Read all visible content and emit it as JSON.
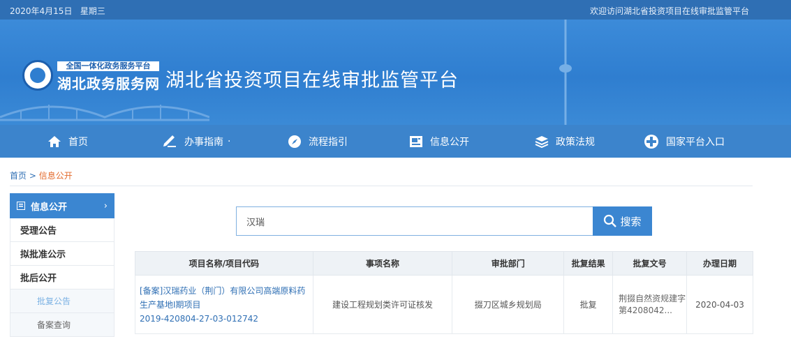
{
  "topbar": {
    "date": "2020年4月15日",
    "weekday": "星期三",
    "welcome": "欢迎访问湖北省投资项目在线审批监管平台"
  },
  "banner": {
    "logo_small": "全国一体化政务服务平台",
    "logo_name": "湖北政务服务网",
    "platform_title": "湖北省投资项目在线审批监管平台"
  },
  "nav": {
    "items": [
      {
        "label": "首页",
        "icon": "home-icon"
      },
      {
        "label": "办事指南",
        "icon": "pen-icon",
        "has_dropdown": true,
        "dropdown_mark": "·"
      },
      {
        "label": "流程指引",
        "icon": "compass-icon"
      },
      {
        "label": "信息公开",
        "icon": "document-icon"
      },
      {
        "label": "政策法规",
        "icon": "layers-icon"
      },
      {
        "label": "国家平台入口",
        "icon": "plus-circle-icon"
      }
    ]
  },
  "breadcrumb": {
    "home": "首页",
    "separator": ">",
    "current": "信息公开"
  },
  "sidebar": {
    "head": "信息公开",
    "arrow": "›",
    "items": [
      "受理公告",
      "拟批准公示",
      "批后公开"
    ],
    "subitems": [
      {
        "label": "批复公告",
        "active": true
      },
      {
        "label": "备案查询",
        "active": false
      }
    ]
  },
  "search": {
    "value": "汉瑞",
    "button_label": "搜索"
  },
  "table": {
    "headers": [
      "项目名称/项目代码",
      "事项名称",
      "审批部门",
      "批复结果",
      "批复文号",
      "办理日期"
    ],
    "rows": [
      {
        "project_name": "[备案]汉瑞药业（荆门）有限公司高端原料药生产基地Ⅰ期项目",
        "project_code": "2019-420804-27-03-012742",
        "item_name": "建设工程规划类许可证核发",
        "department": "掇刀区城乡规划局",
        "result": "批复",
        "doc_number": "荆掇自然资规建字第4208042...",
        "date": "2020-04-03"
      }
    ]
  },
  "colors": {
    "primary": "#3b86d1",
    "topbar": "#2f6fb4",
    "accent": "#e36a2b"
  }
}
